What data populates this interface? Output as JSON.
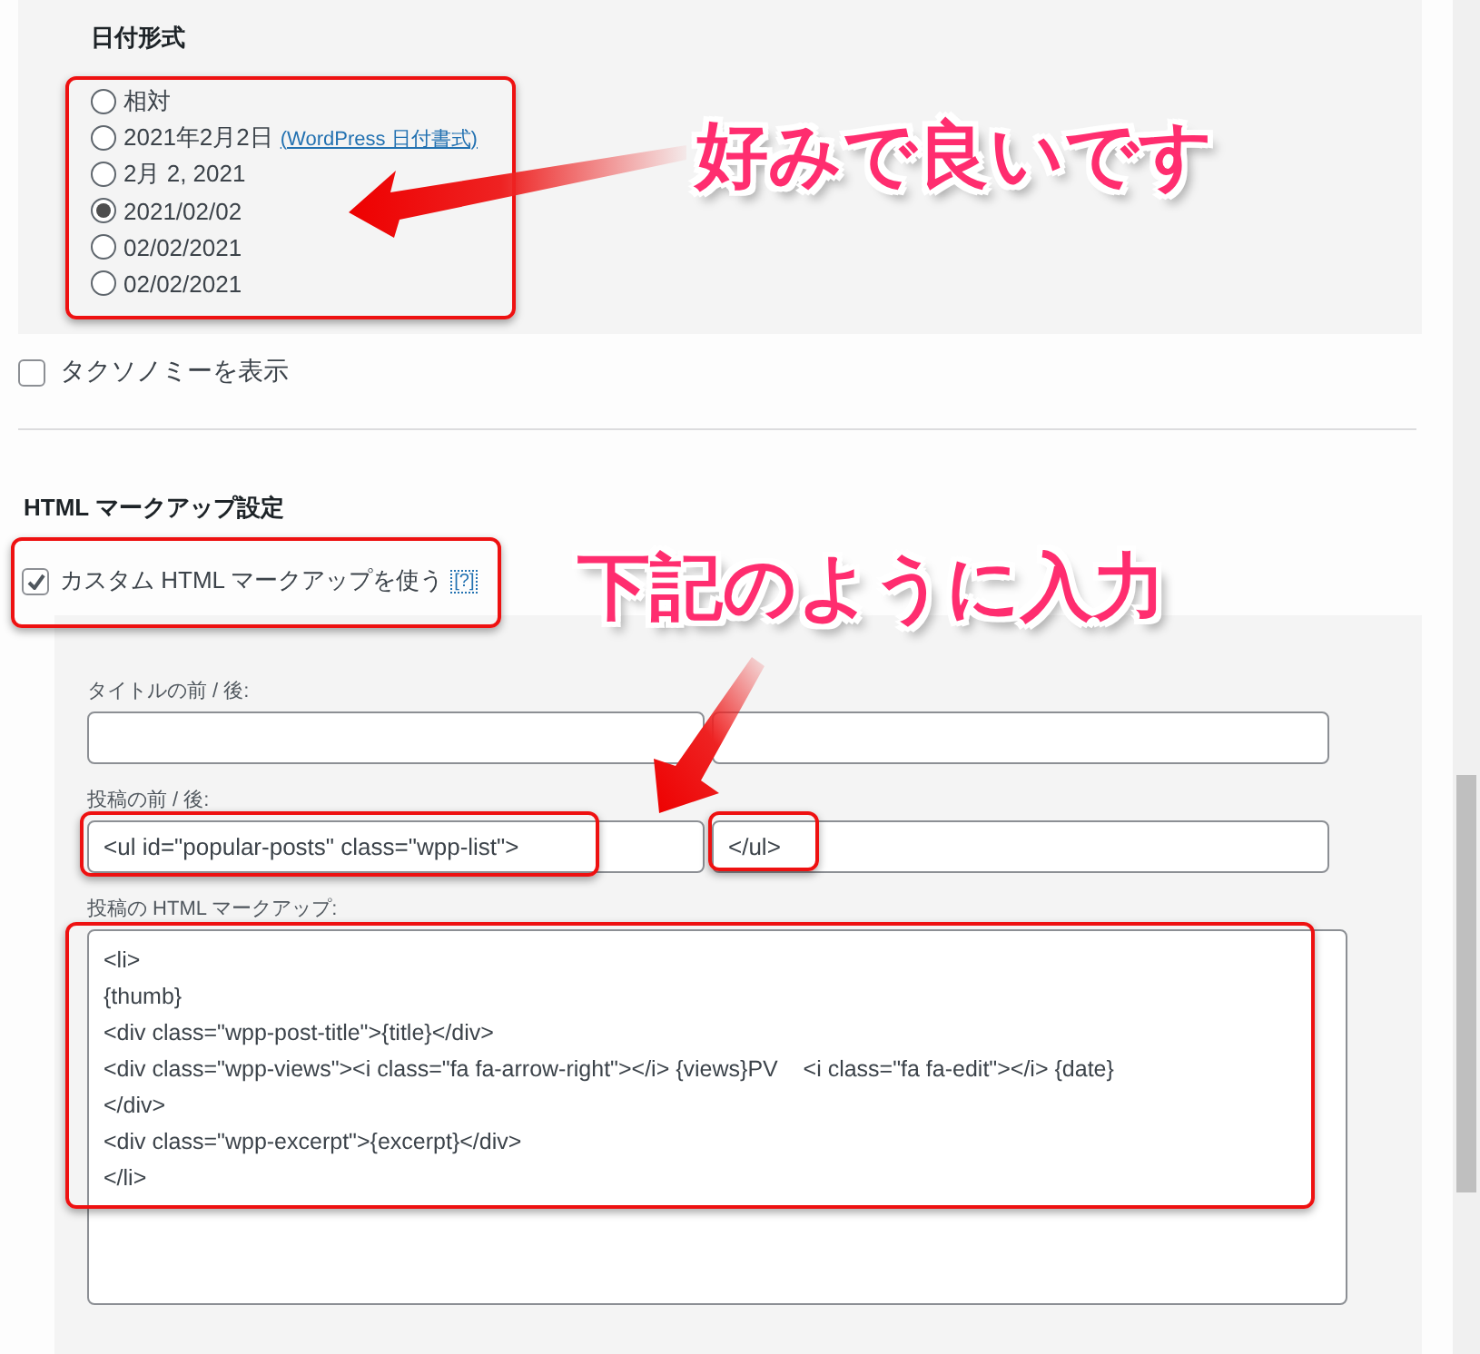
{
  "date_format": {
    "heading": "日付形式",
    "options": [
      {
        "label": "相対",
        "selected": false
      },
      {
        "label": "2021年2月2日",
        "link": "(WordPress 日付書式)",
        "selected": false
      },
      {
        "label": "2月 2, 2021",
        "selected": false
      },
      {
        "label": "2021/02/02",
        "selected": true
      },
      {
        "label": "02/02/2021",
        "selected": false
      },
      {
        "label": "02/02/2021",
        "selected": false
      }
    ]
  },
  "taxonomy": {
    "label": "タクソノミーを表示",
    "checked": false
  },
  "html_markup": {
    "heading": "HTML マークアップ設定",
    "custom": {
      "label": "カスタム HTML マークアップを使う",
      "help": "[?]",
      "checked": true
    },
    "title_before_after": {
      "label": "タイトルの前 / 後:"
    },
    "post_before_after": {
      "label": "投稿の前 / 後:",
      "before": "<ul id=\"popular-posts\" class=\"wpp-list\">",
      "after": "</ul>"
    },
    "post_markup": {
      "label": "投稿の HTML マークアップ:",
      "lines": [
        "<li>",
        "{thumb}",
        "<div class=\"wpp-post-title\">{title}</div>",
        "<div class=\"wpp-views\"><i class=\"fa fa-arrow-right\"></i> {views}PV    <i class=\"fa fa-edit\"></i> {date}",
        "</div>",
        "<div class=\"wpp-excerpt\">{excerpt}</div>",
        "</li>"
      ]
    }
  },
  "annotations": [
    {
      "text": "好みで良いです"
    },
    {
      "text": "下記のように入力"
    }
  ]
}
